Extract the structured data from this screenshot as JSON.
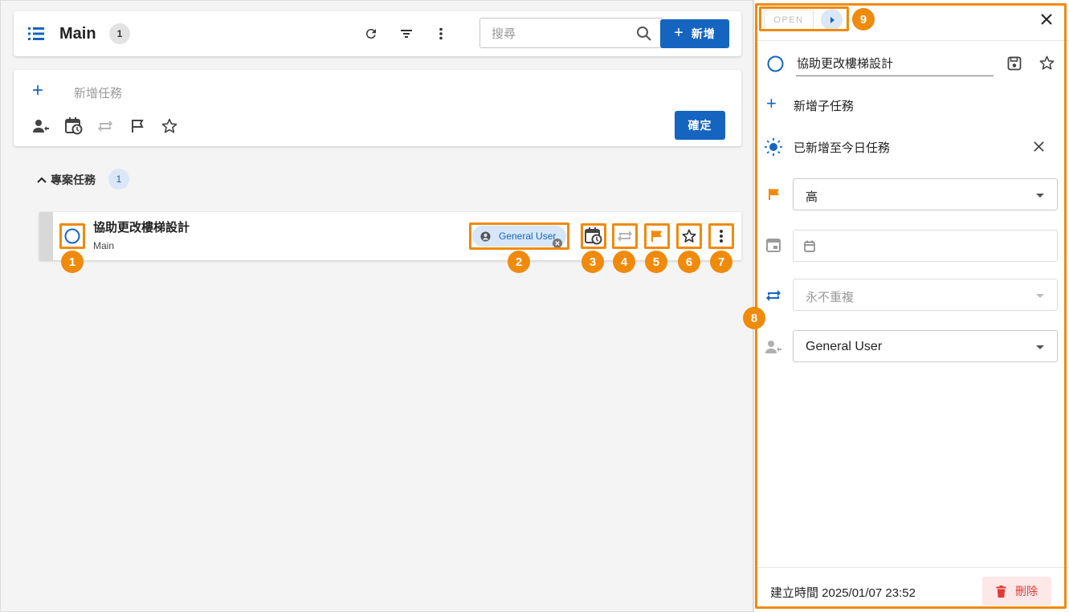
{
  "header": {
    "list_title": "Main",
    "list_count": "1",
    "search_placeholder": "搜尋",
    "new_button": "新增"
  },
  "composer": {
    "placeholder": "新增任務",
    "confirm_button": "確定"
  },
  "section": {
    "title": "專案任務",
    "count": "1"
  },
  "task": {
    "title": "協助更改樓梯設計",
    "project": "Main",
    "assignee": "General User"
  },
  "annotations": [
    "1",
    "2",
    "3",
    "4",
    "5",
    "6",
    "7",
    "8",
    "9"
  ],
  "detail": {
    "status_label": "OPEN",
    "title": "協助更改樓梯設計",
    "add_subtask": "新增子任務",
    "today_label": "已新增至今日任務",
    "priority_value": "高",
    "date_value": "",
    "repeat_value": "永不重複",
    "assignee_value": "General User",
    "created_label": "建立時間 2025/01/07 23:52",
    "delete_button": "刪除"
  },
  "colors": {
    "primary": "#1565c0",
    "annotation": "#f08a0b",
    "flag": "#f08a0b",
    "delete": "#e53935"
  }
}
